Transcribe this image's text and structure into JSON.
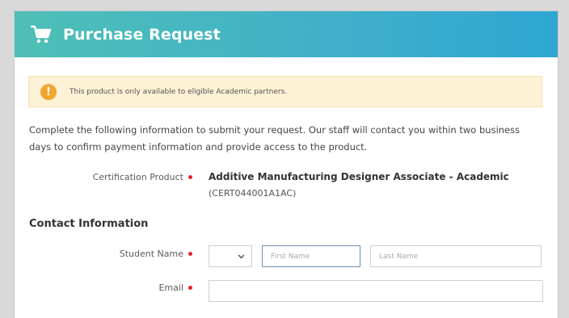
{
  "header": {
    "title": "Purchase Request",
    "icon": "shopping-cart-icon",
    "gradient": [
      "#4fbfb6",
      "#2ea6d3"
    ]
  },
  "alert": {
    "message": "This product is only available to eligible Academic partners.",
    "icon": "exclamation-icon",
    "icon_text": "!"
  },
  "intro": "Complete the following information to submit your request. Our staff will contact you within two business days to confirm payment information and provide access to the product.",
  "certification": {
    "label": "Certification Product",
    "product_name": "Additive Manufacturing Designer Associate - Academic",
    "product_code": "(CERT044001A1AC)"
  },
  "contact": {
    "section_title": "Contact Information",
    "student_name_label": "Student Name",
    "title_select_value": "",
    "first_name_placeholder": "First Name",
    "last_name_placeholder": "Last Name",
    "email_label": "Email",
    "email_value": ""
  },
  "required_color": "#e0242b"
}
